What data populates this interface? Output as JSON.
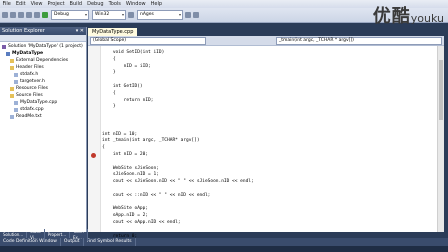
{
  "menu": [
    "File",
    "Edit",
    "View",
    "Project",
    "Build",
    "Debug",
    "Tools",
    "Window",
    "Help"
  ],
  "toolbar": {
    "config": "Debug",
    "platform": "Win32",
    "search": "nAges"
  },
  "brand": {
    "main": "优酷",
    "sub": "youku"
  },
  "sidebar": {
    "title": "Solution Explorer",
    "pin": "▾ ✕",
    "items": [
      {
        "label": "Solution 'MyDataType' (1 project)",
        "icon": "solution-icon"
      },
      {
        "label": "MyDataType",
        "icon": "project-icon"
      },
      {
        "label": "External Dependencies",
        "icon": "folder-icon"
      },
      {
        "label": "Header Files",
        "icon": "folder-icon"
      },
      {
        "label": "stdafx.h",
        "icon": "file-icon"
      },
      {
        "label": "targetver.h",
        "icon": "file-icon"
      },
      {
        "label": "Resource Files",
        "icon": "folder-icon"
      },
      {
        "label": "Source Files",
        "icon": "folder-icon"
      },
      {
        "label": "MyDataType.cpp",
        "icon": "file-icon"
      },
      {
        "label": "stdafx.cpp",
        "icon": "file-icon"
      },
      {
        "label": "ReadMe.txt",
        "icon": "file-icon"
      }
    ]
  },
  "editor": {
    "tab": "MyDataType.cpp",
    "scope": "(Global Scope)",
    "function": "_tmain(int argc, _TCHAR * argv[])",
    "code": [
      "    void SetID(int iID)",
      "    {",
      "        nID = iID;",
      "    }",
      "",
      "    int GetID()",
      "    {",
      "        return nID;",
      "    }",
      "",
      "",
      "",
      "int nID = 10;",
      "int _tmain(int argc, _TCHAR* argv[])",
      "{",
      "    int nID = 20;",
      "",
      "    WebSite sJieSoon;",
      "    sJieSoon.nID = 1;",
      "    cout << sJieSoon.nID << \" \" << sJieSoon.nID << endl;",
      "",
      "    cout << ::nID << \" \" << nID << endl;",
      "",
      "    WebSite oApp;",
      "    oApp.nID = 2;",
      "    cout << oApp.nID << endl;",
      "",
      "    return 0;"
    ]
  },
  "bottom_tabs": [
    "Solution...",
    "Class Vi...",
    "Propert...",
    "Team Ex..."
  ],
  "bottom_tabs2": [
    "Code Definition Window",
    "Output",
    "Find Symbol Results"
  ]
}
